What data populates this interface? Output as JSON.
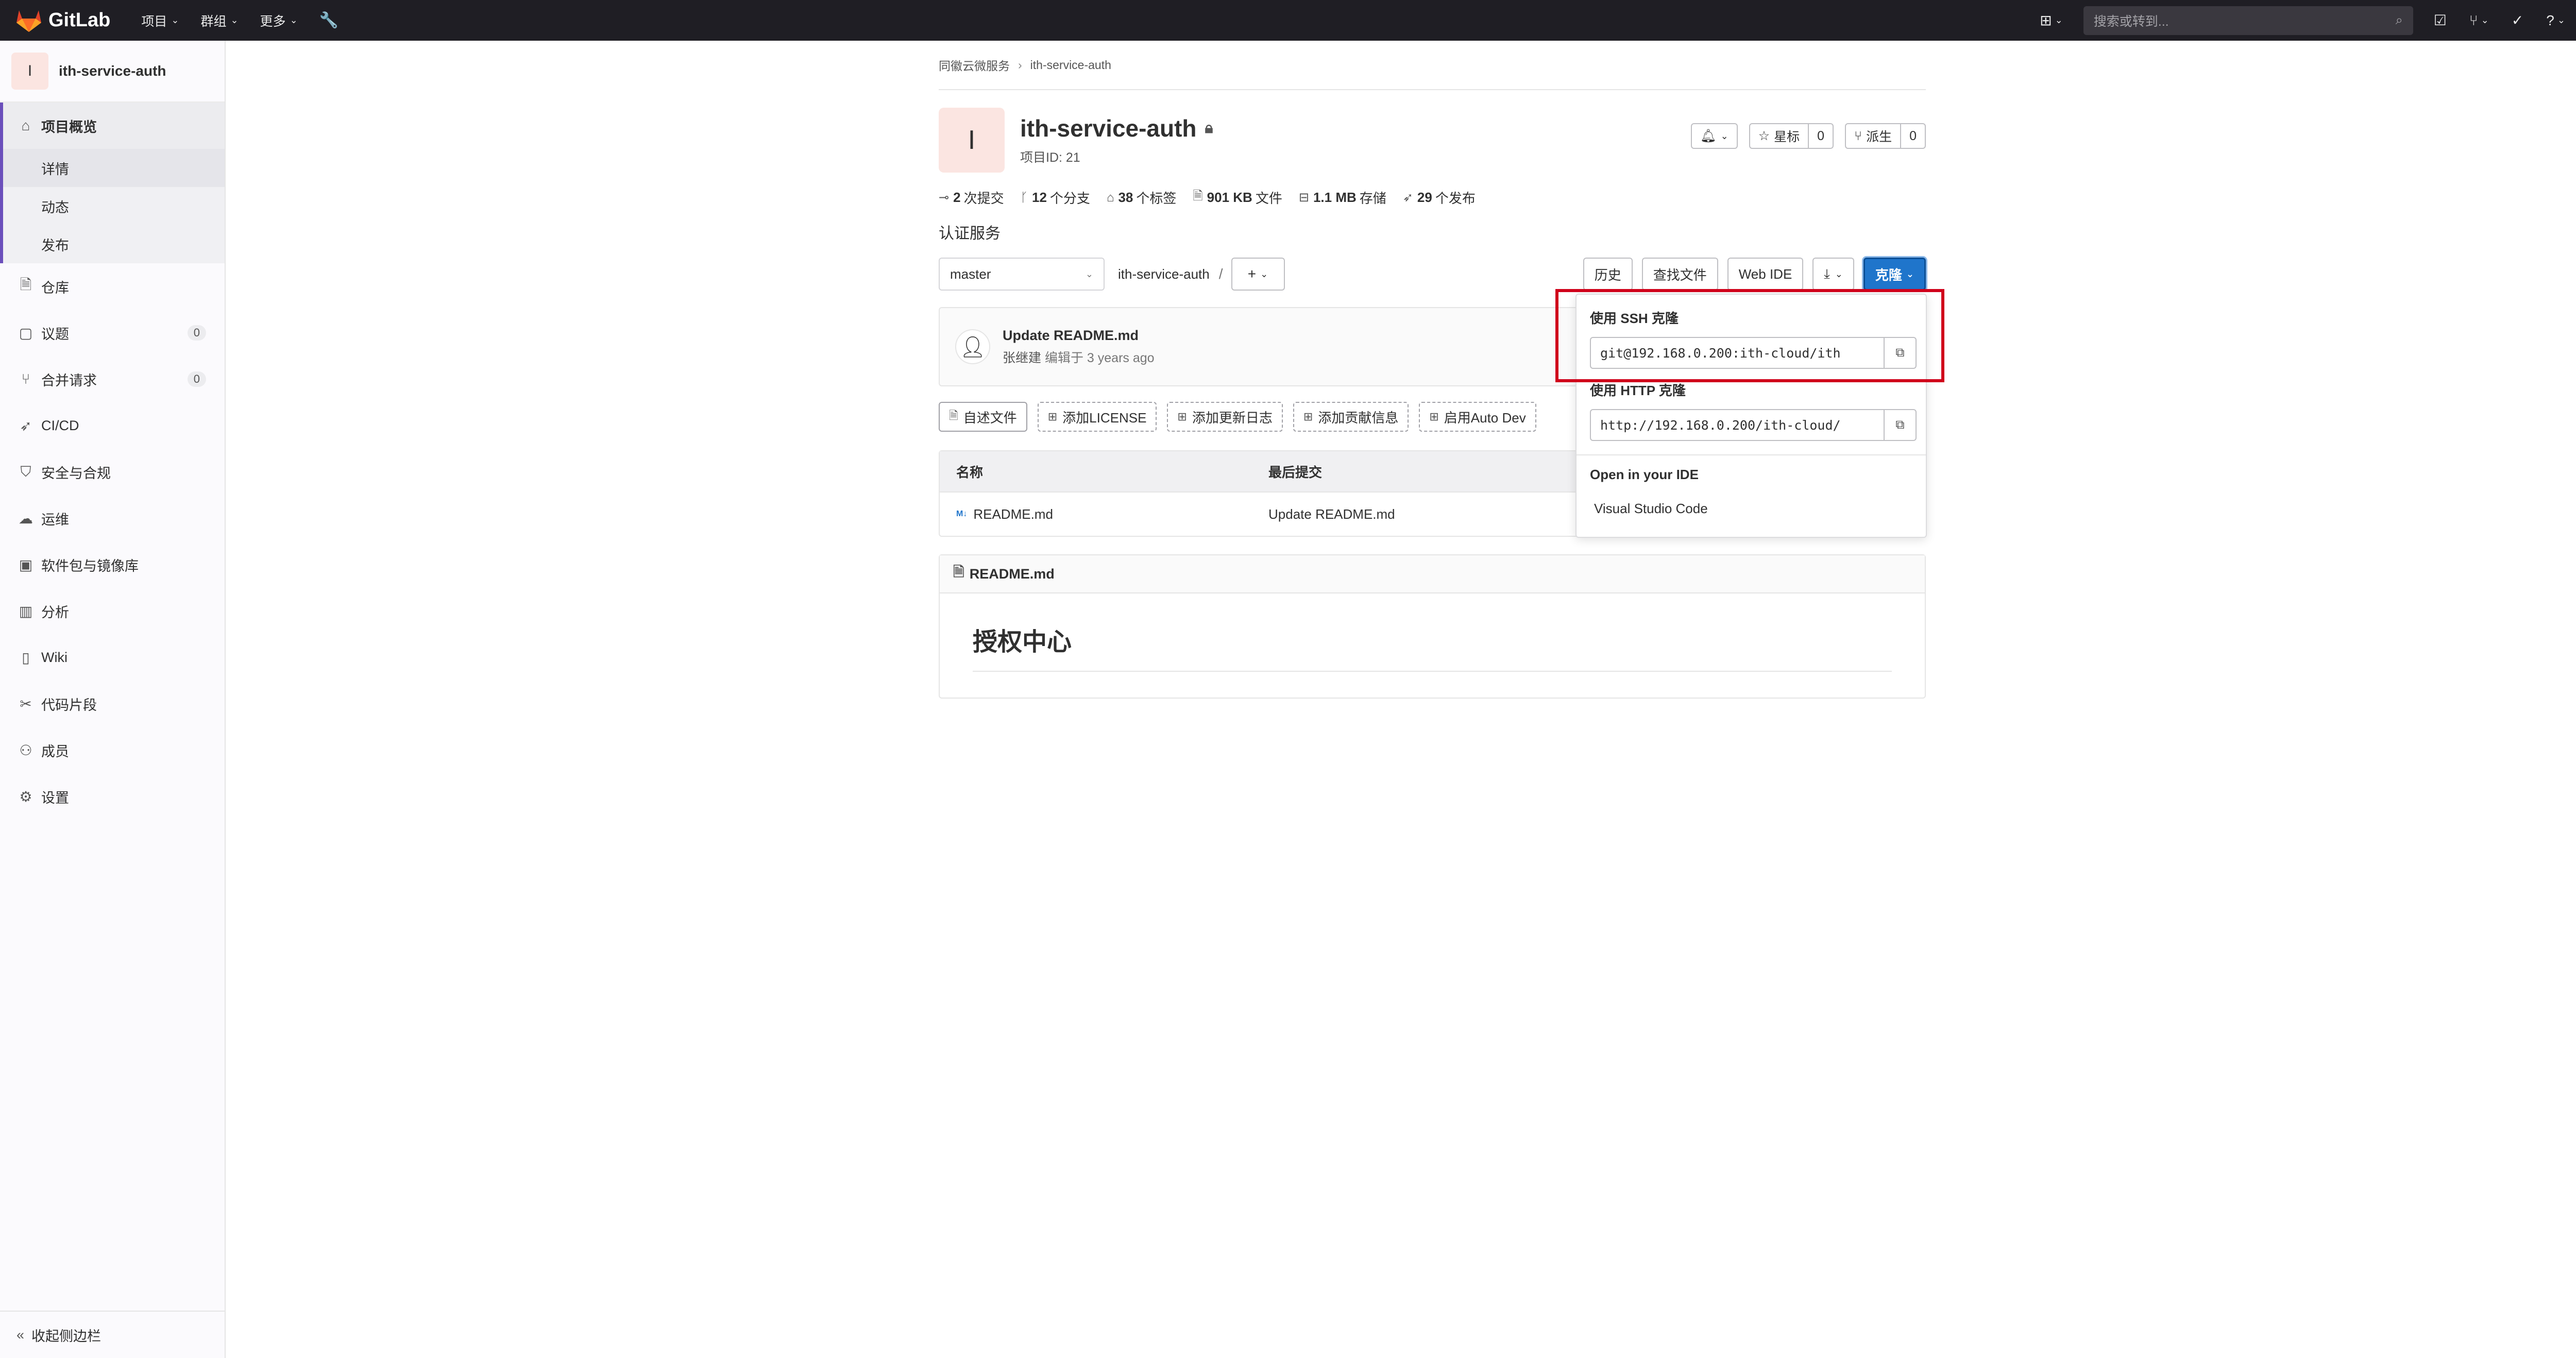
{
  "topbar": {
    "brand": "GitLab",
    "nav": [
      {
        "label": "项目"
      },
      {
        "label": "群组"
      },
      {
        "label": "更多"
      }
    ],
    "search_placeholder": "搜索或转到..."
  },
  "sidebar": {
    "project_initial": "I",
    "project_name": "ith-service-auth",
    "overview_label": "项目概览",
    "overview_sub": [
      "详情",
      "动态",
      "发布"
    ],
    "items": [
      {
        "label": "仓库",
        "icon": "doc-icon"
      },
      {
        "label": "议题",
        "icon": "issues-icon",
        "count": "0"
      },
      {
        "label": "合并请求",
        "icon": "merge-icon",
        "count": "0"
      },
      {
        "label": "CI/CD",
        "icon": "rocket-icon"
      },
      {
        "label": "安全与合规",
        "icon": "shield-icon"
      },
      {
        "label": "运维",
        "icon": "cloud-icon"
      },
      {
        "label": "软件包与镜像库",
        "icon": "package-icon"
      },
      {
        "label": "分析",
        "icon": "chart-icon"
      },
      {
        "label": "Wiki",
        "icon": "book-icon"
      },
      {
        "label": "代码片段",
        "icon": "scissors-icon"
      },
      {
        "label": "成员",
        "icon": "users-icon"
      },
      {
        "label": "设置",
        "icon": "gear-icon"
      }
    ],
    "collapse_label": "收起侧边栏"
  },
  "breadcrumb": {
    "group": "同徽云微服务",
    "project": "ith-service-auth"
  },
  "project": {
    "initial": "I",
    "title": "ith-service-auth",
    "id_text": "项目ID: 21",
    "star_label": "星标",
    "star_count": "0",
    "fork_label": "派生",
    "fork_count": "0",
    "description": "认证服务"
  },
  "stats": [
    {
      "value": "2",
      "label": "次提交"
    },
    {
      "value": "12",
      "label": "个分支"
    },
    {
      "value": "38",
      "label": "个标签"
    },
    {
      "value": "901 KB",
      "label": "文件"
    },
    {
      "value": "1.1 MB",
      "label": "存储"
    },
    {
      "value": "29",
      "label": "个发布"
    }
  ],
  "toolbar": {
    "branch": "master",
    "path": "ith-service-auth",
    "slash": "/",
    "history": "历史",
    "find_file": "查找文件",
    "web_ide": "Web IDE",
    "clone": "克隆"
  },
  "commit": {
    "message": "Update README.md",
    "author": "张继建",
    "edited": "编辑于 3 years ago"
  },
  "actions": [
    "自述文件",
    "添加LICENSE",
    "添加更新日志",
    "添加贡献信息",
    "启用Auto Dev"
  ],
  "filetable": {
    "headers": [
      "名称",
      "最后提交"
    ],
    "rows": [
      {
        "name": "README.md",
        "commit": "Update README.md"
      }
    ]
  },
  "readme": {
    "filename": "README.md",
    "heading": "授权中心"
  },
  "clone_dropdown": {
    "ssh_label": "使用 SSH 克隆",
    "ssh_url": "git@192.168.0.200:ith-cloud/ith",
    "http_label": "使用 HTTP 克隆",
    "http_url": "http://192.168.0.200/ith-cloud/",
    "ide_label": "Open in your IDE",
    "ide_option": "Visual Studio Code"
  },
  "colors": {
    "topbar_bg": "#1f1e24",
    "primary": "#1f75cb",
    "highlight": "#d0021b"
  }
}
